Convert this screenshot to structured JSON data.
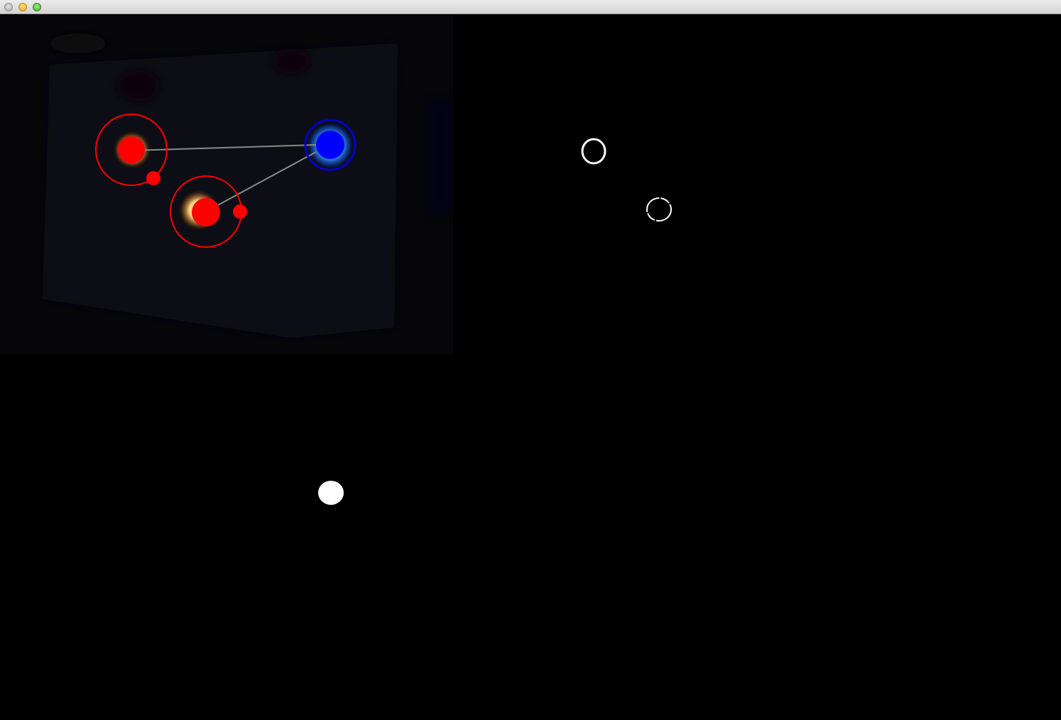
{
  "window": {
    "title": "",
    "buttons": {
      "close": "close-button",
      "minimize": "minimize-button",
      "maximize": "maximize-button"
    }
  },
  "panes": {
    "camera": {
      "background_color": "#060508",
      "card_color": "#111016",
      "tracked_markers": [
        {
          "id": "red-marker-1",
          "color": "#ff0000",
          "glow": "#ffe0a0"
        },
        {
          "id": "red-marker-2",
          "color": "#ff0000",
          "glow": "#ffe0a0"
        },
        {
          "id": "blue-marker",
          "color": "#0000ff",
          "glow": "#3a9cff"
        }
      ],
      "link_color": "#8a8a8a"
    },
    "mask_red": {
      "background_color": "#000000",
      "blob_color": "#ffffff",
      "blobs": 2
    },
    "mask_blue": {
      "background_color": "#000000",
      "blob_color": "#ffffff",
      "blobs": 1
    }
  }
}
